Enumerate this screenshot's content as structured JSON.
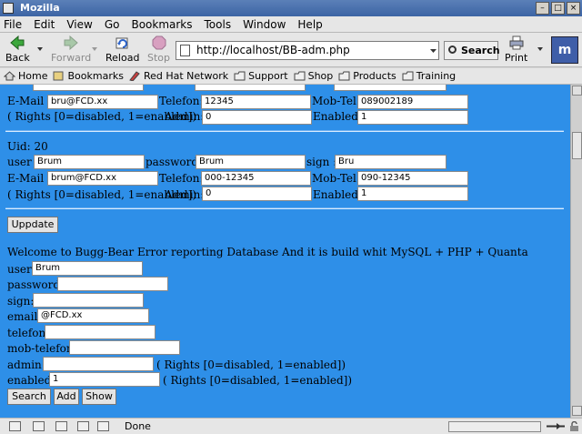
{
  "window": {
    "title": "Mozilla",
    "btn_min": "–",
    "btn_max": "□",
    "btn_close": "×"
  },
  "menu": [
    "File",
    "Edit",
    "View",
    "Go",
    "Bookmarks",
    "Tools",
    "Window",
    "Help"
  ],
  "nav": {
    "back": "Back",
    "forward": "Forward",
    "reload": "Reload",
    "stop": "Stop",
    "url": "http://localhost/BB-adm.php",
    "search": "Search",
    "print": "Print"
  },
  "bookmarks": [
    "Home",
    "Bookmarks",
    "Red Hat Network",
    "Support",
    "Shop",
    "Products",
    "Training"
  ],
  "record1": {
    "labels": {
      "email": "E-Mail :",
      "telefon": "Telefon:",
      "mobtel": "Mob-Tel:",
      "rights": "( Rights [0=disabled, 1=enabled])",
      "admin": "Admin:",
      "enabled": "Enabled:"
    },
    "email": "bru@FCD.xx",
    "telefon": "12345",
    "mobtel": "089002189",
    "admin": "0",
    "enabled": "1"
  },
  "record2": {
    "uid": "Uid: 20",
    "labels": {
      "user": "user :",
      "password": "password:",
      "sign": "sign :",
      "email": "E-Mail :",
      "telefon": "Telefon:",
      "mobtel": "Mob-Tel:",
      "rights": "( Rights [0=disabled, 1=enabled])",
      "admin": "Admin:",
      "enabled": "Enabled:"
    },
    "user": "Brum",
    "password": "Brum",
    "sign": "Bru",
    "email": "brum@FCD.xx",
    "telefon": "000-12345",
    "mobtel": "090-12345",
    "admin": "0",
    "enabled": "1"
  },
  "update_button": "Uppdate",
  "welcome": "Welcome to Bugg-Bear Error reporting Database And it is build whit MySQL + PHP + Quanta",
  "form": {
    "labels": {
      "user": "user:",
      "password": "password:",
      "sign": "sign:",
      "email": "email:",
      "telefon": "telefon:",
      "mobtelefon": "mob-telefon:",
      "admin": "admin:",
      "enabled": "enabled:",
      "rights": "( Rights [0=disabled, 1=enabled])"
    },
    "user": "Brum",
    "password": "",
    "sign": "",
    "email": "@FCD.xx",
    "telefon": "",
    "mobtelefon": "",
    "admin": "",
    "enabled": "1"
  },
  "buttons": {
    "search": "Search",
    "add": "Add",
    "show": "Show"
  },
  "status": "Done"
}
